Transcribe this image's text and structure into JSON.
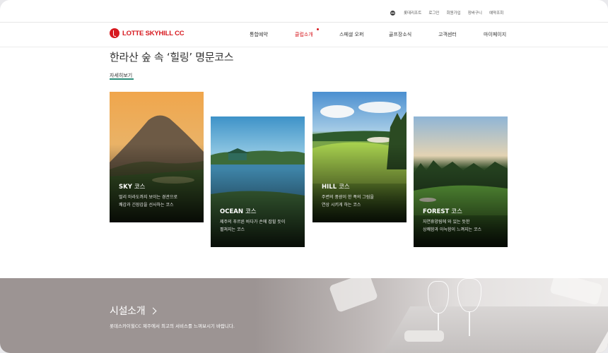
{
  "util_nav": {
    "items": [
      "롯데리조트",
      "로그인",
      "회원가입",
      "장바구니",
      "예약조회"
    ]
  },
  "header": {
    "logo_text": "LOTTE SKYHILL CC",
    "nav": [
      "통합예약",
      "클럽소개",
      "스페셜 오퍼",
      "골프장소식",
      "고객센터",
      "마이페이지"
    ],
    "active_nav": "클럽소개"
  },
  "intro": {
    "headline": "한라산 숲 속 ‘힐링’ 명문코스",
    "more_label": "자세히보기"
  },
  "courses": [
    {
      "title_en": "SKY",
      "title_kr": "코스",
      "desc": [
        "멀리 마라도까지 보이는 경관으로",
        "쾌감과 긴장감을 선사하는 코스"
      ]
    },
    {
      "title_en": "OCEAN",
      "title_kr": "코스",
      "desc": [
        "제주의 푸르른 바다가 손에 잡힐 듯이",
        "펼쳐지는 코스"
      ]
    },
    {
      "title_en": "HILL",
      "title_kr": "코스",
      "desc": [
        "주변의 풍광이 한 폭의 그림을",
        "연상 시키게 하는 코스"
      ]
    },
    {
      "title_en": "FOREST",
      "title_kr": "코스",
      "desc": [
        "자연휴양림에 와 있는 듯한",
        "상쾌함과 아늑함이 느껴지는 코스"
      ]
    }
  ],
  "facility": {
    "title": "시설소개",
    "desc": "롯데스카이힐CC 제주에서 최고의 서비스를 느껴보시기 바랍니다."
  },
  "colors": {
    "brand": "#d7191f",
    "accent_underline": "#2e8f7c"
  }
}
